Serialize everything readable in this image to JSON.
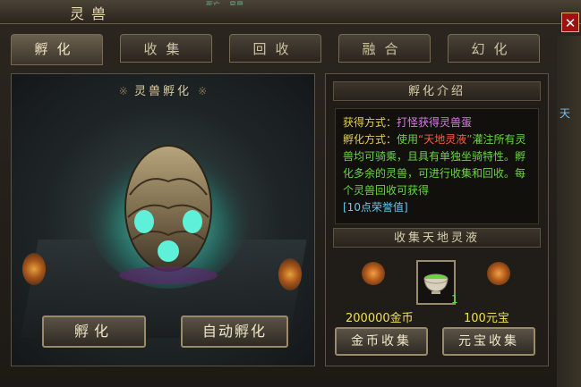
{
  "window": {
    "title": "灵兽",
    "top_strip_text": "死亡    星晨"
  },
  "tabs": [
    {
      "label": "孵化",
      "active": true
    },
    {
      "label": "收集",
      "active": false
    },
    {
      "label": "回收",
      "active": false
    },
    {
      "label": "融合",
      "active": false
    },
    {
      "label": "幻化",
      "active": false
    }
  ],
  "left_panel": {
    "header": "灵兽孵化",
    "hatch_button": "孵化",
    "auto_hatch_button": "自动孵化"
  },
  "right_panel": {
    "intro_header": "孵化介绍",
    "intro": {
      "line1_label": "获得方式：",
      "line1_text": "打怪获得灵兽蛋",
      "line2_label": "孵化方式：",
      "line2_text_prefix": "使用",
      "line2_highlight": "“天地灵液”",
      "line2_text_suffix": "灌注所有灵兽均可骑乘，且具有单独坐骑特性。孵化多余的灵兽，可进行收集和回收。每个灵兽回收可获得",
      "line2_reward": "[10点荣誉值]"
    },
    "collect_header": "收集天地灵液",
    "item": {
      "name": "天地灵液",
      "count": "1",
      "icon": "green-potion-bowl-icon"
    },
    "gold_price": "200000金币",
    "yuanbao_price": "100元宝",
    "gold_collect_button": "金币收集",
    "yuanbao_collect_button": "元宝收集"
  },
  "right_edge_text": "天"
}
